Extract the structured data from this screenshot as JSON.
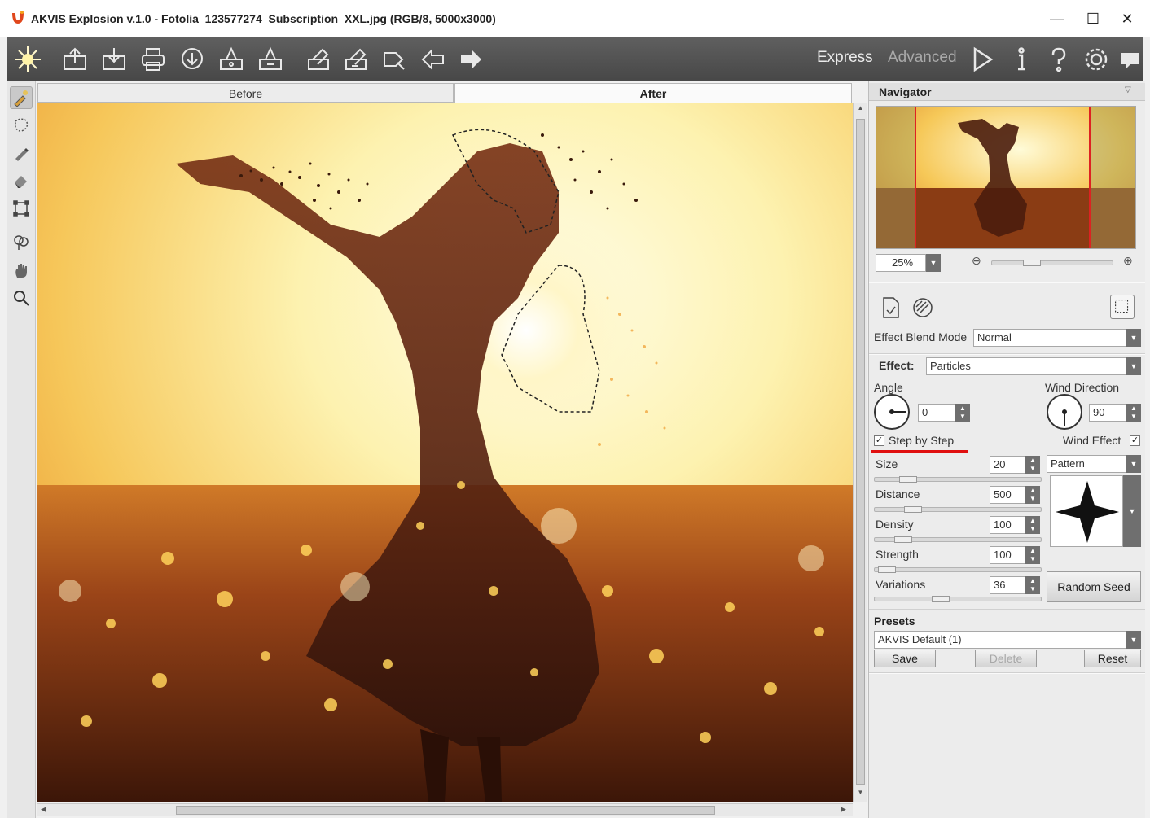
{
  "window": {
    "title": "AKVIS Explosion v.1.0 - Fotolia_123577274_Subscription_XXL.jpg (RGB/8, 5000x3000)",
    "minimize": "—",
    "maximize": "☐",
    "close": "✕"
  },
  "toolbar": {
    "mode_express": "Express",
    "mode_advanced": "Advanced"
  },
  "tabs": {
    "before": "Before",
    "after": "After"
  },
  "navigator": {
    "title": "Navigator",
    "zoom": "25%"
  },
  "effect_panel": {
    "blend_mode_label": "Effect Blend Mode",
    "blend_mode_value": "Normal",
    "effect_label": "Effect:",
    "effect_value": "Particles",
    "angle_label": "Angle",
    "angle_value": "0",
    "wind_direction_label": "Wind Direction",
    "wind_direction_value": "90",
    "step_by_step_label": "Step by Step",
    "wind_effect_label": "Wind Effect",
    "shape_value": "Pattern",
    "random_seed": "Random Seed",
    "params": [
      {
        "label": "Size",
        "value": "20"
      },
      {
        "label": "Distance",
        "value": "500"
      },
      {
        "label": "Density",
        "value": "100"
      },
      {
        "label": "Strength",
        "value": "100"
      },
      {
        "label": "Variations",
        "value": "36"
      }
    ]
  },
  "presets": {
    "title": "Presets",
    "selected": "AKVIS Default (1)",
    "save": "Save",
    "delete": "Delete",
    "reset": "Reset"
  }
}
